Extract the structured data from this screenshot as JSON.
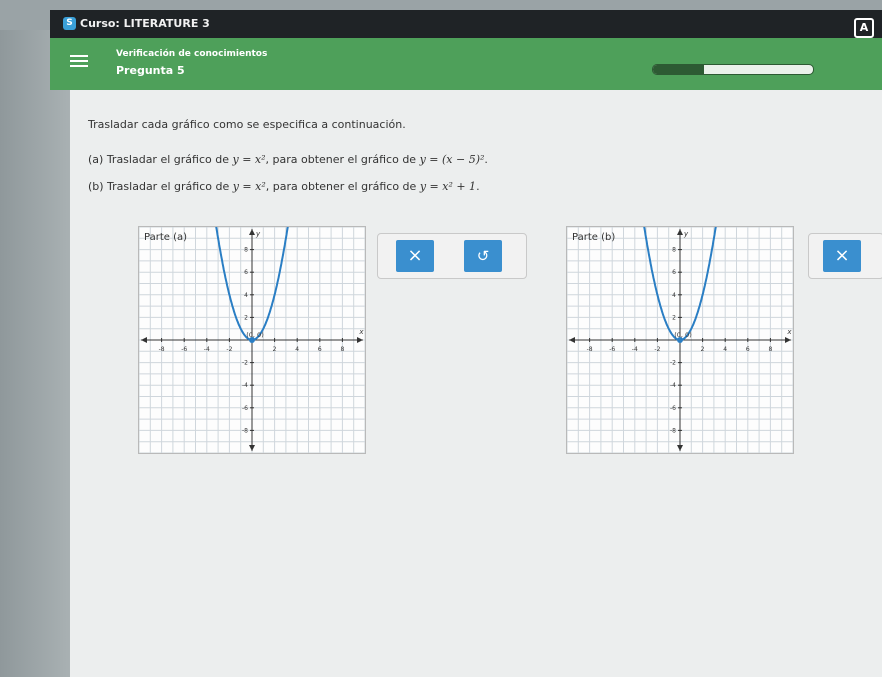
{
  "window": {
    "app_badge": "S",
    "title": "Curso: LITERATURE 3",
    "right_badge": "A"
  },
  "header": {
    "subtitle": "Verificación de conocimientos",
    "question": "Pregunta 5",
    "progress": 0.32
  },
  "instructions": {
    "intro": "Trasladar cada gráfico como se especifica a continuación.",
    "a": {
      "prefix": "(a) Trasladar el gráfico de",
      "f1": "y = x²",
      "mid": ", para obtener el gráfico de",
      "f2": "y = (x − 5)²",
      "end": "."
    },
    "b": {
      "prefix": "(b) Trasladar el gráfico de",
      "f1": "y = x²",
      "mid": ", para obtener el gráfico de",
      "f2": "y = x² + 1",
      "end": "."
    }
  },
  "graphs": [
    {
      "label": "Parte (a)",
      "vertex_label": "(0, 0)",
      "x_axis": "x",
      "y_axis": "y",
      "x_ticks": [
        "-8",
        "-6",
        "-4",
        "-2",
        "2",
        "4",
        "6",
        "8"
      ],
      "y_ticks": [
        "8",
        "6",
        "4",
        "2",
        "-2",
        "-4",
        "-6",
        "-8"
      ]
    },
    {
      "label": "Parte (b)",
      "vertex_label": "(0, 0)",
      "x_axis": "x",
      "y_axis": "y",
      "x_ticks": [
        "-8",
        "-6",
        "-4",
        "-2",
        "2",
        "4",
        "6",
        "8"
      ],
      "y_ticks": [
        "8",
        "6",
        "4",
        "2",
        "-2",
        "-4",
        "-6",
        "-8"
      ]
    }
  ],
  "buttons": {
    "clear": "×",
    "undo": "↺",
    "clear_b": "×"
  }
}
